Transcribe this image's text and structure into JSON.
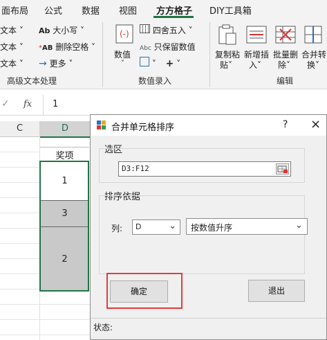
{
  "tabs": [
    "面布局",
    "公式",
    "数据",
    "视图",
    "方方格子",
    "DIY工具箱"
  ],
  "ribbon": {
    "text_group": {
      "items": [
        "文本",
        "文本",
        "文本"
      ],
      "case_label": "大小写",
      "delete_space_label": "删除空格",
      "more_label": "更多",
      "group_label": "高级文本处理"
    },
    "number_group": {
      "value_label": "数值",
      "round_label": "四舍五入",
      "keep_value_label": "只保留数值",
      "group_label": "数值录入"
    },
    "edit_group": {
      "copy_paste_label": [
        "复制粘",
        "贴"
      ],
      "insert_label": [
        "新增插",
        "入"
      ],
      "batch_delete_label": [
        "批量删",
        "除"
      ],
      "merge_label": [
        "合并转",
        "换"
      ],
      "group_label": "编辑"
    }
  },
  "formula_bar": {
    "value": "1"
  },
  "sheet": {
    "columns": [
      "C",
      "D"
    ],
    "header_cell": "奖项",
    "values": [
      "1",
      "3",
      "2"
    ]
  },
  "dialog": {
    "title": "合并单元格排序",
    "help_icon": "?",
    "close_icon": "×",
    "range_group_label": "选区",
    "range_value": "D3:F12",
    "sort_group_label": "排序依据",
    "column_label": "列:",
    "column_value": "D",
    "order_value": "按数值升序",
    "ok_label": "确定",
    "exit_label": "退出",
    "status_label": "状态:"
  },
  "colors": {
    "accent_green": "#217346",
    "highlight_red": "#e83a3a"
  }
}
